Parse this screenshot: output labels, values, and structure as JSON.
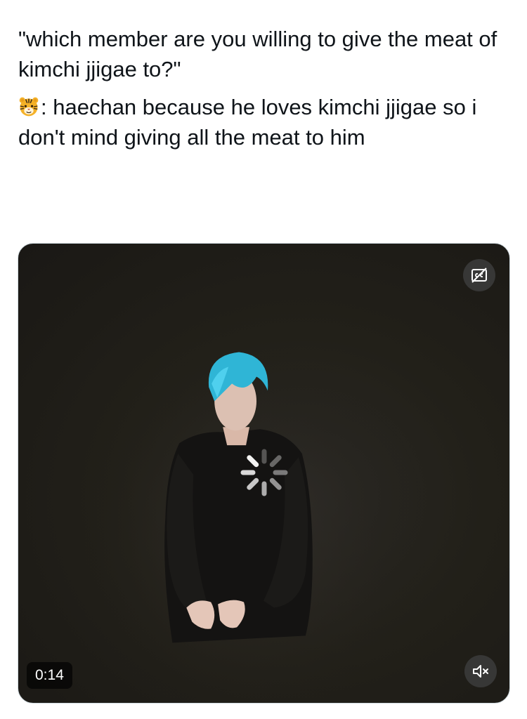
{
  "tweet": {
    "question": "\"which member are you willing to give the meat of kimchi jjigae to?\"",
    "answer_emoji": "tiger-face-icon",
    "answer": ": haechan because he loves kimchi jjigae so i don't mind giving all the meat to him"
  },
  "video": {
    "timestamp": "0:14",
    "captions_icon": "closed-captions-off-icon",
    "mute_icon": "speaker-muted-icon",
    "loading_icon": "loading-spinner-icon"
  }
}
